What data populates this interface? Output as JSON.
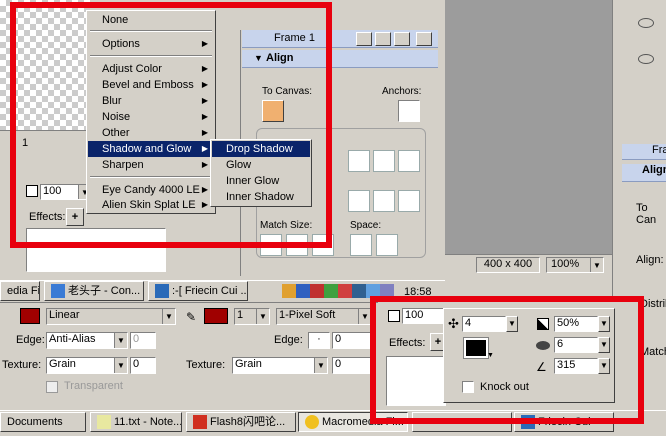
{
  "context_menu": {
    "items": [
      {
        "label": "None",
        "arrow": false
      },
      {
        "label": "Options",
        "arrow": true
      },
      {
        "label": "Adjust Color",
        "arrow": true
      },
      {
        "label": "Bevel and Emboss",
        "arrow": true
      },
      {
        "label": "Blur",
        "arrow": true
      },
      {
        "label": "Noise",
        "arrow": true
      },
      {
        "label": "Other",
        "arrow": true
      },
      {
        "label": "Shadow and Glow",
        "arrow": true
      },
      {
        "label": "Sharpen",
        "arrow": true
      },
      {
        "label": "Eye Candy 4000 LE",
        "arrow": true
      },
      {
        "label": "Alien Skin Splat LE",
        "arrow": true
      }
    ]
  },
  "submenu": {
    "items": [
      "Drop Shadow",
      "Glow",
      "Inner Glow",
      "Inner Shadow"
    ]
  },
  "left_props": {
    "opacity_value": "100",
    "effects_label": "Effects:"
  },
  "frame_panel": {
    "title": "Frame 1"
  },
  "align_panel": {
    "title": "Align",
    "to_canvas": "To Canvas:",
    "anchors": "Anchors:",
    "match_size": "Match Size:",
    "space": "Space:",
    "align_label": "Align:",
    "distribute_label": "Distrib",
    "match_label": "Match",
    "to_can_label": "To Can",
    "fram_label": "Fra"
  },
  "canvas_size": "400 x 400",
  "zoom": "100%",
  "taskbar_top": {
    "items": [
      "edia Fi...",
      "老头子 - Con...",
      ":-[ Friecin Cui ..."
    ],
    "clock": "18:58"
  },
  "properties": {
    "fill_type": "Linear",
    "edge_label": "Edge:",
    "edge_value": "Anti-Alias",
    "edge_num": "0",
    "texture_label": "Texture:",
    "texture_value": "Grain",
    "texture_num": "0",
    "transparent": "Transparent",
    "stroke_size": "1",
    "stroke_type": "1-Pixel Soft",
    "edge_num2": "0",
    "texture_value2": "Grain",
    "texture_num2": "0",
    "opacity_value": "100",
    "effects_label": "Effects:"
  },
  "drop_shadow": {
    "distance": "4",
    "opacity": "50%",
    "softness": "6",
    "angle": "315",
    "knockout": "Knock out"
  },
  "taskbar_bottom": {
    "items": [
      "Documents",
      "11.txt - Note...",
      "Flash8闪吧论...",
      "Macromedia Fi...",
      "",
      "Friecin Cui"
    ]
  },
  "colors": {
    "highlight": "#0a246a",
    "red_frame": "#e8000e",
    "panel_header": "#c8d4ec"
  }
}
